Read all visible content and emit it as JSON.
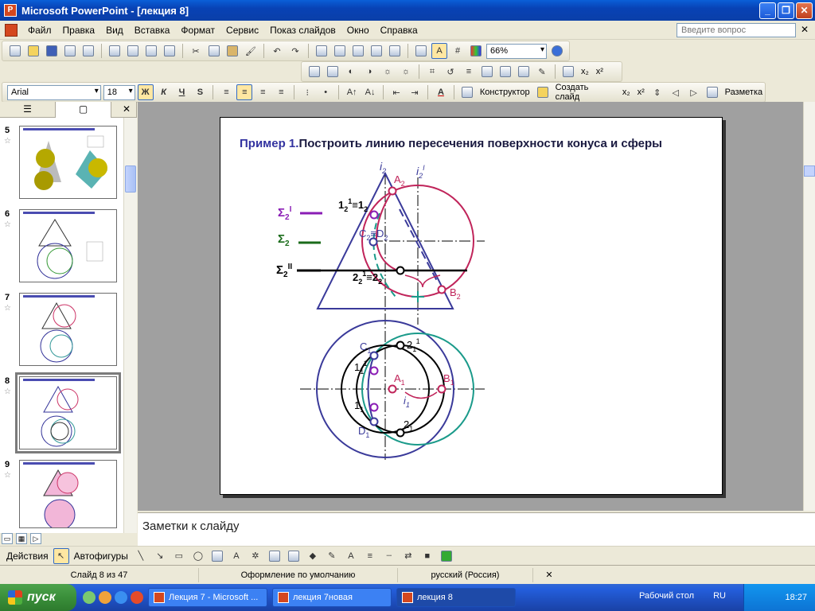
{
  "window": {
    "title": "Microsoft PowerPoint - [лекция 8]"
  },
  "menu": {
    "items": [
      "Файл",
      "Правка",
      "Вид",
      "Вставка",
      "Формат",
      "Сервис",
      "Показ слайдов",
      "Окно",
      "Справка"
    ],
    "help_placeholder": "Введите вопрос"
  },
  "toolbar": {
    "zoom": "66%",
    "font": "Arial",
    "font_size": "18",
    "bold": "Ж",
    "italic": "К",
    "underline": "Ч",
    "shadow": "S",
    "design_label": "Конструктор",
    "new_slide_label": "Создать слайд",
    "layout_label": "Разметка",
    "sub": "x₂",
    "sup": "x²"
  },
  "slides_pane": {
    "thumbs": [
      {
        "num": "5"
      },
      {
        "num": "6"
      },
      {
        "num": "7"
      },
      {
        "num": "8",
        "selected": true
      },
      {
        "num": "9"
      }
    ]
  },
  "slide": {
    "title_prefix": "Пример 1.",
    "title_rest": "Построить линию пересечения поверхности конуса и сферы",
    "labels": {
      "i2": "i",
      "i2_sub": "2",
      "i2p": "i",
      "i2p_sub": "2",
      "A2": "A",
      "A2_sub": "2",
      "B2": "B",
      "B2_sub": "2",
      "C2D2": "C",
      "one": "1",
      "two": "2",
      "sigma": "Σ",
      "C1": "C",
      "D1": "D",
      "A1": "A",
      "B1": "B",
      "i1": "i",
      "eq": "≡",
      "sub1": "1",
      "sub2": "2",
      "supI": "I",
      "supII": "II"
    }
  },
  "notes": {
    "placeholder": "Заметки к слайду"
  },
  "drawing": {
    "actions": "Действия",
    "autoshapes": "Автофигуры"
  },
  "status": {
    "slide": "Слайд 8 из 47",
    "design": "Оформление по умолчанию",
    "language": "русский (Россия)"
  },
  "taskbar": {
    "start": "пуск",
    "tasks": [
      "Лекция 7 - Microsoft ...",
      "лекция 7новая",
      "лекция 8"
    ],
    "desktop": "Рабочий стол",
    "lang": "RU",
    "time": "18:27"
  }
}
